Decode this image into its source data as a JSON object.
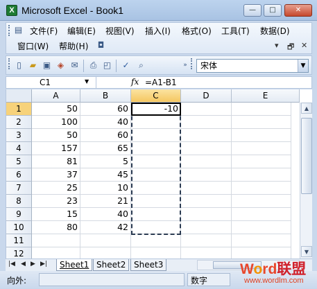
{
  "window": {
    "title": "Microsoft Excel - Book1",
    "app_icon_letter": "X",
    "min": "—",
    "max": "□",
    "close": "✕"
  },
  "menu": {
    "row1": [
      "文件(F)",
      "编辑(E)",
      "视图(V)",
      "插入(I)",
      "格式(O)",
      "工具(T)",
      "数据(D)"
    ],
    "row2": [
      "窗口(W)",
      "帮助(H)"
    ],
    "controls": {
      "minimize": "▾",
      "restore": "🗗",
      "close": "✕"
    }
  },
  "toolbar": {
    "icons": [
      "new-icon",
      "open-icon",
      "save-icon",
      "permission-icon",
      "email-icon",
      "print-icon",
      "print-preview-icon",
      "spelling-icon",
      "research-icon"
    ],
    "font": "宋体"
  },
  "formula_bar": {
    "name_box": "C1",
    "fx": "fx",
    "formula": "=A1-B1"
  },
  "sheet": {
    "columns": [
      "A",
      "B",
      "C",
      "D",
      "E"
    ],
    "rows": [
      "1",
      "2",
      "3",
      "4",
      "5",
      "6",
      "7",
      "8",
      "9",
      "10",
      "11",
      "12"
    ],
    "cells": [
      [
        "50",
        "60",
        "-10"
      ],
      [
        "100",
        "40",
        ""
      ],
      [
        "50",
        "60",
        ""
      ],
      [
        "157",
        "65",
        ""
      ],
      [
        "81",
        "5",
        ""
      ],
      [
        "37",
        "45",
        ""
      ],
      [
        "25",
        "10",
        ""
      ],
      [
        "23",
        "21",
        ""
      ],
      [
        "15",
        "40",
        ""
      ],
      [
        "80",
        "42",
        ""
      ],
      [
        "",
        "",
        ""
      ],
      [
        "",
        "",
        ""
      ]
    ],
    "selected_column": "C",
    "selected_row": "1"
  },
  "tabs": {
    "sheets": [
      "Sheet1",
      "Sheet2",
      "Sheet3"
    ],
    "active": "Sheet1"
  },
  "status": {
    "left": "向外:",
    "mode": "数字"
  },
  "watermark": {
    "brand_w": "W",
    "brand_o": "o",
    "brand_rd": "rd",
    "brand_cn": "联盟",
    "url": "www.wordlm.com"
  }
}
